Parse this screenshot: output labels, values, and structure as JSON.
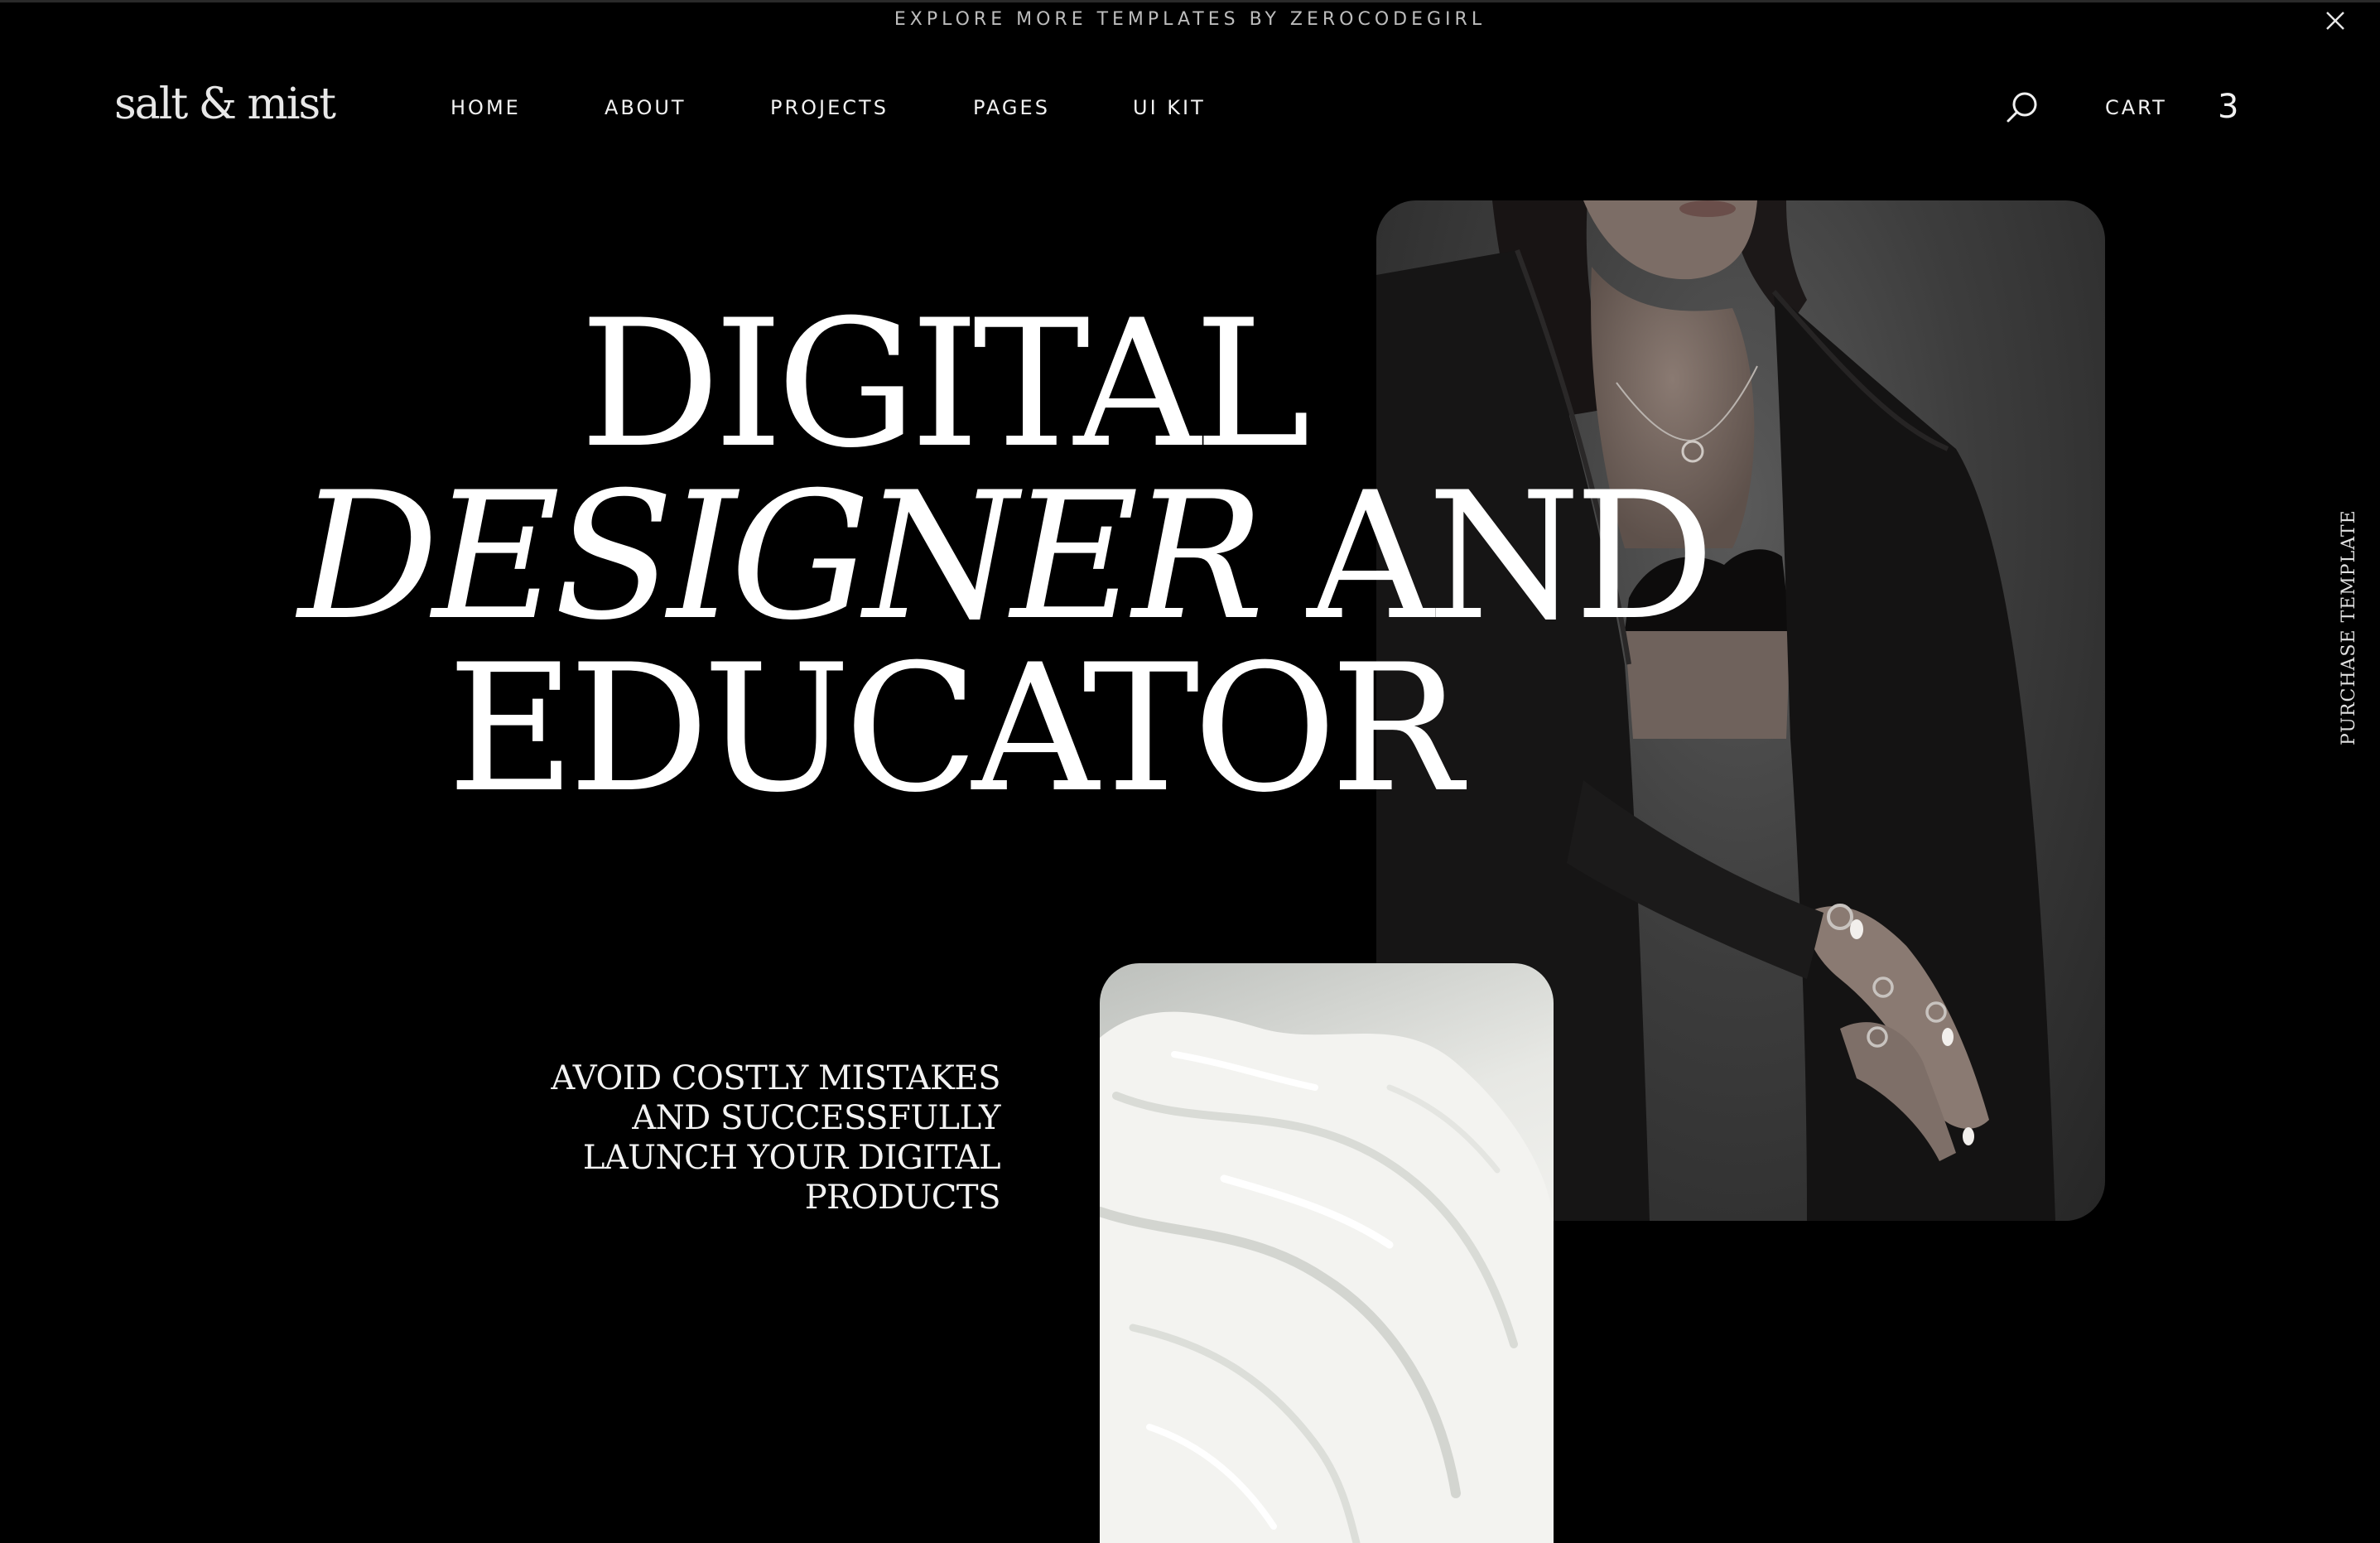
{
  "announcement": {
    "text": "EXPLORE MORE TEMPLATES BY ZEROCODEGIRL"
  },
  "header": {
    "logo": "salt & mist",
    "nav": [
      {
        "label": "HOME"
      },
      {
        "label": "ABOUT"
      },
      {
        "label": "PROJECTS"
      },
      {
        "label": "PAGES"
      },
      {
        "label": "UI KIT"
      }
    ],
    "cart_label": "CART",
    "cart_count": "3"
  },
  "hero": {
    "line1": "DIGITAL",
    "line2_italic": "DESIGNER",
    "line2_rest": " AND",
    "line3": "EDUCATOR",
    "tagline_lines": [
      "AVOID COSTLY MISTAKES",
      "AND SUCCESSFULLY",
      "LAUNCH YOUR DIGITAL",
      "PRODUCTS"
    ]
  },
  "side": {
    "purchase_label": "PURCHASE TEMPLATE"
  }
}
